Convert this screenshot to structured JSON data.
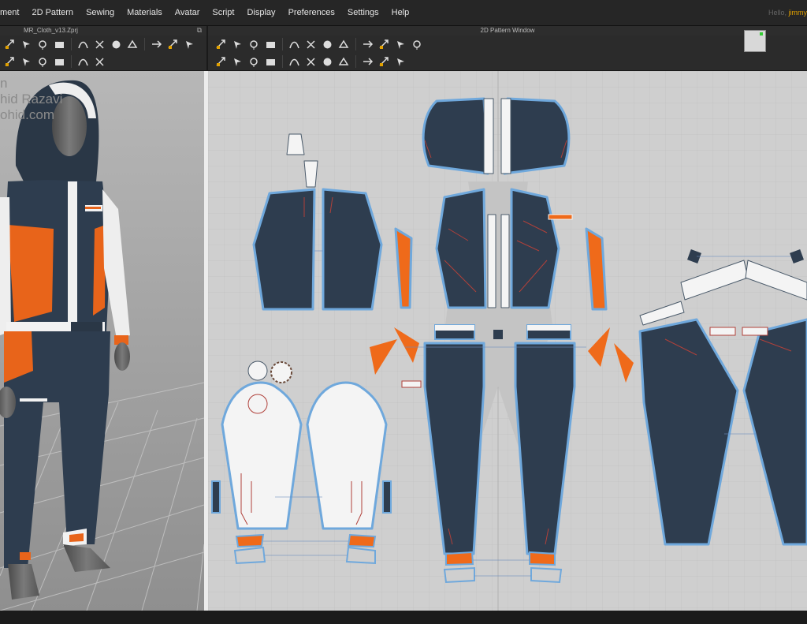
{
  "menu": {
    "items": [
      "ment",
      "2D Pattern",
      "Sewing",
      "Materials",
      "Avatar",
      "Script",
      "Display",
      "Preferences",
      "Settings",
      "Help"
    ]
  },
  "header": {
    "greeting_prefix": "Hello, ",
    "greeting_user": "jimmy"
  },
  "panel3d": {
    "file_name": "MR_Cloth_v13.Zprj",
    "watermark": [
      "n",
      "hid Razavi",
      "ohid.com"
    ]
  },
  "panel2d": {
    "title": "2D Pattern Window"
  },
  "toolbar_icons_3d_row1": [
    "move-icon",
    "select-icon",
    "pin-icon",
    "fold-icon",
    "arrange-icon",
    "tack-icon",
    "sewing-icon",
    "steam-icon",
    "puckering-icon",
    "shrink-icon",
    "measure-icon"
  ],
  "toolbar_icons_3d_row2": [
    "scissors-icon",
    "cut-icon",
    "pin-tool-icon",
    "strengthen-icon",
    "hang-icon",
    "stitch-icon"
  ],
  "toolbar_icons_2d_row1": [
    "transform-icon",
    "edit-point-icon",
    "curve-icon",
    "polygon-icon",
    "rectangle-icon",
    "ellipse-icon",
    "internal-line-icon",
    "internal-rect-icon",
    "dart-icon",
    "trace-icon",
    "symmetry-icon",
    "segment-icon"
  ],
  "toolbar_icons_2d_row2": [
    "seam-icon",
    "free-seam-icon",
    "fold-arrange-icon",
    "tack-2d-icon",
    "puckering-2d-icon",
    "elastic-icon",
    "gather-icon",
    "button-icon",
    "zipper-icon",
    "topstitch-icon",
    "measure-2d-icon"
  ],
  "colors": {
    "fabric_navy": "#2e3d4f",
    "accent_orange": "#ef6a1a",
    "trim_white": "#f4f4f4",
    "outline_blue": "#6fa8dc",
    "grid_bg": "#cfcfcf",
    "viewport_bg": "#a9a9a9"
  }
}
